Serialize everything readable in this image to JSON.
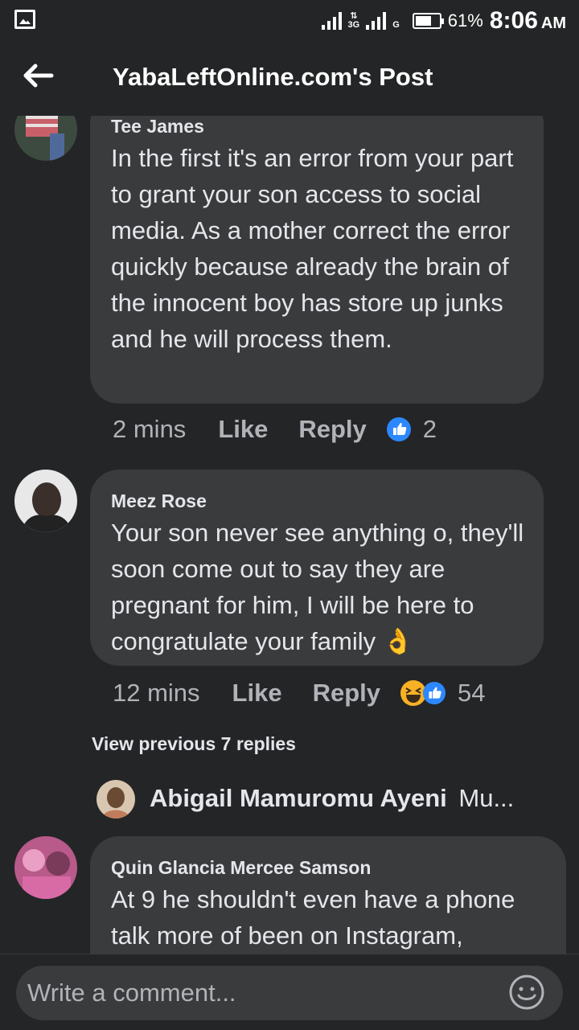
{
  "status": {
    "network1": "3G",
    "network2": "G",
    "battery": "61%",
    "time": "8:06",
    "ampm": "AM"
  },
  "header": {
    "title": "YabaLeftOnline.com's Post"
  },
  "comments": [
    {
      "author": "Tee James",
      "text": "In the first it's an error from your part to grant your son access to social media. As a mother correct the error quickly because already the brain of the innocent boy has store up junks and he will process them.",
      "time": "2 mins",
      "like": "Like",
      "reply": "Reply",
      "reactions": "2",
      "reaction_icons": [
        "like-icon"
      ]
    },
    {
      "author": "Meez Rose",
      "text": "Your son never see anything o, they'll soon come out to say they are pregnant for him, I will be here to congratulate your family",
      "emoji": "👌",
      "time": "12 mins",
      "like": "Like",
      "reply": "Reply",
      "reactions": "54",
      "reaction_icons": [
        "haha-icon",
        "like-icon"
      ]
    },
    {
      "author": "Quin Glancia Mercee Samson",
      "text": "At 9 he shouldn't even have a phone talk more of been on Instagram,"
    }
  ],
  "replies": {
    "view_previous": "View previous 7 replies",
    "preview_author": "Abigail Mamuromu Ayeni",
    "preview_text": "Mu..."
  },
  "composer": {
    "placeholder": "Write a comment..."
  },
  "colors": {
    "background": "#242526",
    "bubble": "#3a3b3c",
    "like_blue": "#2d88ff",
    "haha_yellow": "#f7b125"
  }
}
